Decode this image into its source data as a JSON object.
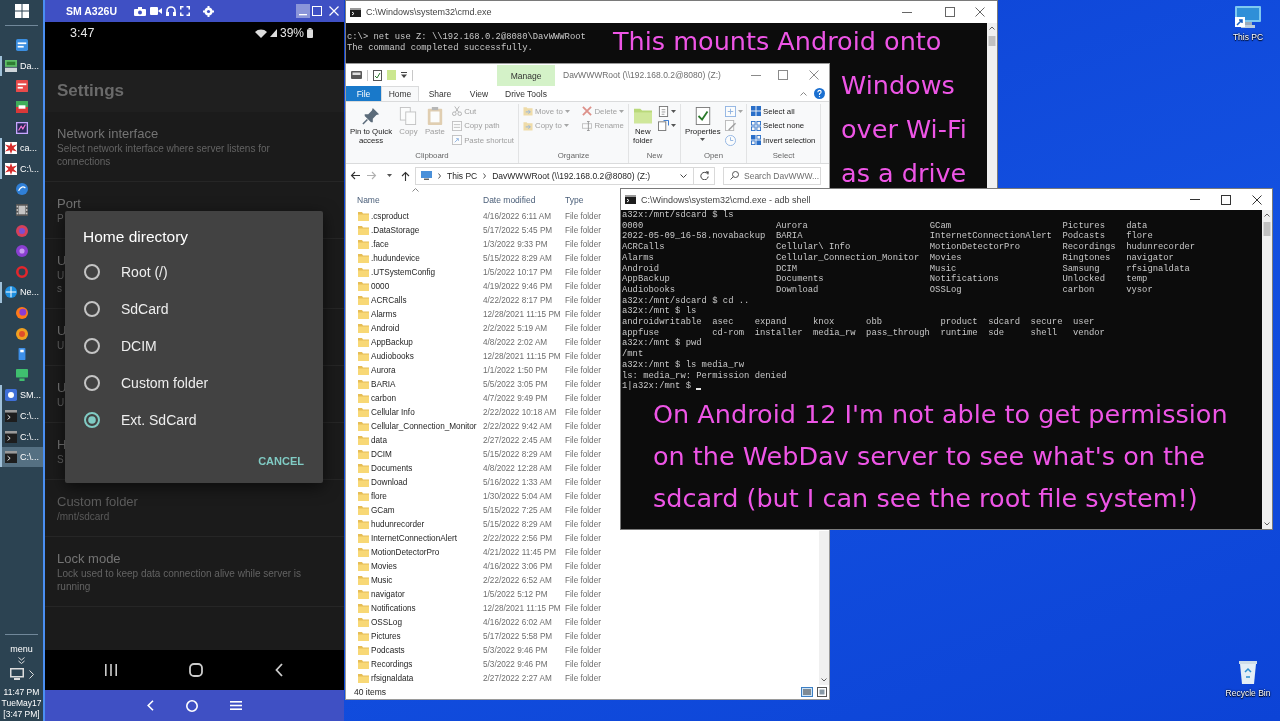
{
  "taskbar": {
    "items": [
      {
        "kind": "pinned",
        "selected": false
      },
      {
        "kind": "window",
        "label": "Da...",
        "selected": false
      },
      {
        "kind": "pinned",
        "selected": false
      },
      {
        "kind": "pinned",
        "selected": false
      },
      {
        "kind": "pinned",
        "selected": false
      },
      {
        "kind": "window",
        "label": "ca...",
        "selected": false
      },
      {
        "kind": "window",
        "label": "C:\\...",
        "selected": false
      },
      {
        "kind": "pinned",
        "selected": false
      },
      {
        "kind": "pinned",
        "selected": false
      },
      {
        "kind": "pinned",
        "selected": false
      },
      {
        "kind": "pinned",
        "selected": false
      },
      {
        "kind": "pinned",
        "selected": false
      },
      {
        "kind": "window",
        "label": "Ne...",
        "selected": false
      },
      {
        "kind": "pinned",
        "selected": false
      },
      {
        "kind": "pinned",
        "selected": false
      },
      {
        "kind": "pinned",
        "selected": false
      },
      {
        "kind": "pinned",
        "selected": false
      },
      {
        "kind": "window",
        "label": "SM...",
        "selected": false
      },
      {
        "kind": "window",
        "label": "C:\\...",
        "selected": false
      },
      {
        "kind": "window",
        "label": "C:\\...",
        "selected": false
      },
      {
        "kind": "window",
        "label": "C:\\...",
        "selected": true
      }
    ],
    "menu_label": "menu",
    "clock": {
      "time": "11:47 PM",
      "date": "TueMay17",
      "phone_time": "[3:47 PM]"
    }
  },
  "phone_window": {
    "title": "SM A326U",
    "status_bar": {
      "time": "3:47",
      "battery": "39%"
    },
    "app_title": "Settings",
    "settings": [
      {
        "title": "Network interface",
        "summary": "Select network interface where server listens for\nconnections",
        "disabled": false
      },
      {
        "title": "Port",
        "summary": "P",
        "disabled": false
      },
      {
        "title": "U",
        "summary": "U\ns",
        "disabled": false
      },
      {
        "title": "U",
        "summary": "U",
        "disabled": false
      },
      {
        "title": "U",
        "summary": "U",
        "disabled": false
      },
      {
        "title": "H",
        "summary": "S",
        "disabled": false
      },
      {
        "title": "Custom folder",
        "summary": "/mnt/sdcard",
        "disabled": true
      },
      {
        "title": "Lock mode",
        "summary": "Lock used to keep data connection alive while server is\nrunning",
        "disabled": false
      }
    ],
    "dialog": {
      "title": "Home directory",
      "options": [
        {
          "label": "Root (/)",
          "selected": false
        },
        {
          "label": "SdCard",
          "selected": false
        },
        {
          "label": "DCIM",
          "selected": false
        },
        {
          "label": "Custom folder",
          "selected": false
        },
        {
          "label": "Ext. SdCard",
          "selected": true
        }
      ],
      "button": "CANCEL"
    }
  },
  "cmd_window": {
    "title": "C:\\Windows\\system32\\cmd.exe",
    "lines": [
      {
        "kind": "line",
        "text": "c:\\> net use Z: \\\\192.168.0.2@8080\\DavWWWRoot"
      },
      {
        "kind": "line",
        "text": "The command completed successfully."
      }
    ],
    "annotation": [
      "This mounts Android onto",
      "Windows",
      "over Wi-Fi",
      "as a drive"
    ]
  },
  "explorer": {
    "context_group": "Manage",
    "title": "DavWWWRoot (\\\\192.168.0.2@8080) (Z:)",
    "tabs": [
      {
        "label": "File",
        "kind": "menu",
        "selected": false
      },
      {
        "label": "Home",
        "kind": "tab",
        "selected": true
      },
      {
        "label": "Share",
        "kind": "tab",
        "selected": false
      },
      {
        "label": "View",
        "kind": "tab",
        "selected": false
      },
      {
        "label": "Drive Tools",
        "kind": "tab",
        "selected": false
      }
    ],
    "ribbon": [
      {
        "label": "Clipboard",
        "columns": [
          [
            {
              "kind": "large",
              "label": "Pin to Quick\naccess",
              "disabled": false,
              "dropdown": false
            }
          ],
          [
            {
              "kind": "large",
              "label": "Copy",
              "disabled": true,
              "dropdown": false
            }
          ],
          [
            {
              "kind": "large",
              "label": "Paste",
              "disabled": true,
              "dropdown": false
            }
          ],
          [
            {
              "kind": "small",
              "label": "Cut",
              "disabled": true,
              "dropdown": false
            },
            {
              "kind": "small",
              "label": "Copy path",
              "disabled": true,
              "dropdown": false
            },
            {
              "kind": "small",
              "label": "Paste shortcut",
              "disabled": true,
              "dropdown": false
            }
          ]
        ]
      },
      {
        "label": "Organize",
        "columns": [
          [
            {
              "kind": "small",
              "label": "Move to",
              "disabled": true,
              "dropdown": true
            },
            {
              "kind": "small",
              "label": "Copy to",
              "disabled": true,
              "dropdown": true
            }
          ],
          [
            {
              "kind": "small",
              "label": "Delete",
              "disabled": true,
              "dropdown": true
            },
            {
              "kind": "small",
              "label": "Rename",
              "disabled": true,
              "dropdown": false
            }
          ]
        ]
      },
      {
        "label": "New",
        "columns": [
          [
            {
              "kind": "large",
              "label": "New\nfolder",
              "disabled": false,
              "dropdown": false
            }
          ],
          [
            {
              "kind": "icon",
              "disabled": false,
              "dropdown": true
            },
            {
              "kind": "icon",
              "disabled": false,
              "dropdown": true
            }
          ]
        ]
      },
      {
        "label": "Open",
        "columns": [
          [
            {
              "kind": "large",
              "label": "Properties",
              "disabled": false,
              "dropdown": true
            }
          ],
          [
            {
              "kind": "icon",
              "disabled": true,
              "dropdown": true
            },
            {
              "kind": "icon",
              "disabled": true,
              "dropdown": false
            },
            {
              "kind": "icon",
              "disabled": true,
              "dropdown": false
            }
          ]
        ]
      },
      {
        "label": "Select",
        "columns": [
          [
            {
              "kind": "small",
              "label": "Select all",
              "disabled": false,
              "dropdown": false
            },
            {
              "kind": "small",
              "label": "Select none",
              "disabled": false,
              "dropdown": false
            },
            {
              "kind": "small",
              "label": "Invert selection",
              "disabled": false,
              "dropdown": false
            }
          ]
        ]
      }
    ],
    "address": [
      "This PC",
      "DavWWWRoot (\\\\192.168.0.2@8080) (Z:)"
    ],
    "search": {
      "placeholder": "Search DavWWW..."
    },
    "columns": [
      "Name",
      "Date modified",
      "Type"
    ],
    "rows": [
      {
        "name": ".csproduct",
        "date": "4/16/2022 6:11 AM",
        "type": "File folder"
      },
      {
        "name": ".DataStorage",
        "date": "5/17/2022 5:45 PM",
        "type": "File folder"
      },
      {
        "name": ".face",
        "date": "1/3/2022 9:33 PM",
        "type": "File folder"
      },
      {
        "name": ".hudundevice",
        "date": "5/15/2022 8:29 AM",
        "type": "File folder"
      },
      {
        "name": ".UTSystemConfig",
        "date": "1/5/2022 10:17 PM",
        "type": "File folder"
      },
      {
        "name": "0000",
        "date": "4/19/2022 9:46 PM",
        "type": "File folder"
      },
      {
        "name": "ACRCalls",
        "date": "4/22/2022 8:17 PM",
        "type": "File folder"
      },
      {
        "name": "Alarms",
        "date": "12/28/2021 11:15 PM",
        "type": "File folder"
      },
      {
        "name": "Android",
        "date": "2/2/2022 5:19 AM",
        "type": "File folder"
      },
      {
        "name": "AppBackup",
        "date": "4/8/2022 2:02 AM",
        "type": "File folder"
      },
      {
        "name": "Audiobooks",
        "date": "12/28/2021 11:15 PM",
        "type": "File folder"
      },
      {
        "name": "Aurora",
        "date": "1/1/2022 1:50 PM",
        "type": "File folder"
      },
      {
        "name": "BARIA",
        "date": "5/5/2022 3:05 PM",
        "type": "File folder"
      },
      {
        "name": "carbon",
        "date": "4/7/2022 9:49 PM",
        "type": "File folder"
      },
      {
        "name": "Cellular Info",
        "date": "2/22/2022 10:18 AM",
        "type": "File folder"
      },
      {
        "name": "Cellular_Connection_Monitor",
        "date": "2/22/2022 9:42 AM",
        "type": "File folder"
      },
      {
        "name": "data",
        "date": "2/27/2022 2:45 AM",
        "type": "File folder"
      },
      {
        "name": "DCIM",
        "date": "5/15/2022 8:29 AM",
        "type": "File folder"
      },
      {
        "name": "Documents",
        "date": "4/8/2022 12:28 AM",
        "type": "File folder"
      },
      {
        "name": "Download",
        "date": "5/16/2022 1:33 AM",
        "type": "File folder"
      },
      {
        "name": "flore",
        "date": "1/30/2022 5:04 AM",
        "type": "File folder"
      },
      {
        "name": "GCam",
        "date": "5/15/2022 7:25 AM",
        "type": "File folder"
      },
      {
        "name": "hudunrecorder",
        "date": "5/15/2022 8:29 AM",
        "type": "File folder"
      },
      {
        "name": "InternetConnectionAlert",
        "date": "2/22/2022 2:56 PM",
        "type": "File folder"
      },
      {
        "name": "MotionDetectorPro",
        "date": "4/21/2022 11:45 PM",
        "type": "File folder"
      },
      {
        "name": "Movies",
        "date": "4/16/2022 3:06 PM",
        "type": "File folder"
      },
      {
        "name": "Music",
        "date": "2/22/2022 6:52 AM",
        "type": "File folder"
      },
      {
        "name": "navigator",
        "date": "1/5/2022 5:12 PM",
        "type": "File folder"
      },
      {
        "name": "Notifications",
        "date": "12/28/2021 11:15 PM",
        "type": "File folder"
      },
      {
        "name": "OSSLog",
        "date": "4/16/2022 6:02 AM",
        "type": "File folder"
      },
      {
        "name": "Pictures",
        "date": "5/17/2022 5:58 PM",
        "type": "File folder"
      },
      {
        "name": "Podcasts",
        "date": "5/3/2022 9:46 PM",
        "type": "File folder"
      },
      {
        "name": "Recordings",
        "date": "5/3/2022 9:46 PM",
        "type": "File folder"
      },
      {
        "name": "rfsignaldata",
        "date": "2/27/2022 2:27 AM",
        "type": "File folder"
      }
    ],
    "status": "40 items"
  },
  "adb_window": {
    "title": "C:\\Windows\\system32\\cmd.exe - adb shell",
    "output": [
      {
        "kind": "line",
        "text": "a32x:/mnt/sdcard $ ls"
      },
      {
        "kind": "listing",
        "rows": [
          [
            "0000",
            "Aurora",
            "GCam",
            "Pictures",
            "data"
          ],
          [
            "2022-05-09_16-58.novabackup",
            "BARIA",
            "InternetConnectionAlert",
            "Podcasts",
            "flore"
          ],
          [
            "ACRCalls",
            "Cellular\\ Info",
            "MotionDetectorPro",
            "Recordings",
            "hudunrecorder"
          ],
          [
            "Alarms",
            "Cellular_Connection_Monitor",
            "Movies",
            "Ringtones",
            "navigator"
          ],
          [
            "Android",
            "DCIM",
            "Music",
            "Samsung",
            "rfsignaldata"
          ],
          [
            "AppBackup",
            "Documents",
            "Notifications",
            "Unlocked",
            "temp"
          ],
          [
            "Audiobooks",
            "Download",
            "OSSLog",
            "carbon",
            "vysor"
          ]
        ]
      },
      {
        "kind": "line",
        "text": "a32x:/mnt/sdcard $ cd .."
      },
      {
        "kind": "line",
        "text": "a32x:/mnt $ ls"
      },
      {
        "kind": "listing",
        "rows": [
          [
            "androidwritable",
            "asec",
            "expand",
            "knox",
            "obb",
            "product",
            "sdcard",
            "secure",
            "user"
          ],
          [
            "appfuse",
            "cd-rom",
            "installer",
            "media_rw",
            "pass_through",
            "runtime",
            "sde",
            "shell",
            "vendor"
          ]
        ]
      },
      {
        "kind": "line",
        "text": "a32x:/mnt $ pwd"
      },
      {
        "kind": "line",
        "text": "/mnt"
      },
      {
        "kind": "line",
        "text": "a32x:/mnt $ ls media_rw"
      },
      {
        "kind": "line",
        "text": "ls: media_rw: Permission denied"
      },
      {
        "kind": "prompt",
        "text": "1|a32x:/mnt $"
      }
    ],
    "annotation": "On Android 12 I'm not able to get permission\non the WebDav server to see what's on the\nsdcard (but I can see the root file system!)"
  },
  "desktop_icons": [
    {
      "label": "This PC"
    },
    {
      "label": "Recycle Bin"
    }
  ]
}
